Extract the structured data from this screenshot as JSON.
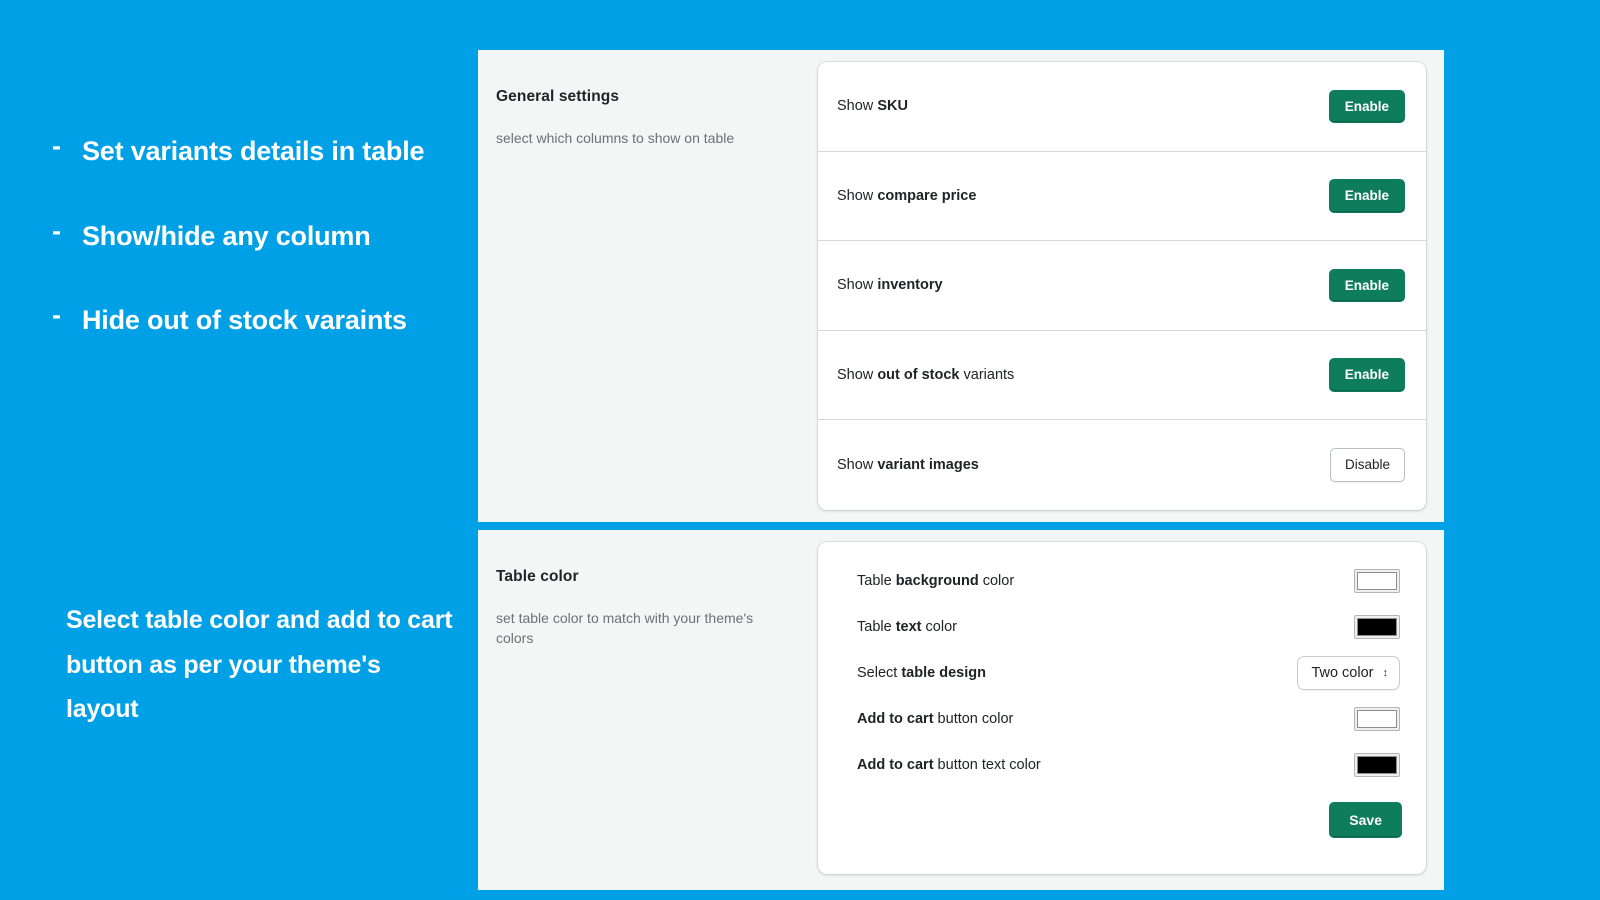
{
  "promo": {
    "bullets": [
      {
        "dash": "-",
        "text": "Set variants details in table"
      },
      {
        "dash": "-",
        "text": "Show/hide any column"
      },
      {
        "dash": "-",
        "text": "Hide out of stock varaints"
      }
    ],
    "paragraph": "Select table color and add to cart button as per your theme's layout"
  },
  "colors": {
    "background_blue": "#00a0e6",
    "panel_grey": "#f4f5f5",
    "primary_green": "#0e7d5b",
    "text_dark": "#212326",
    "text_muted": "#6d7175"
  },
  "general_settings": {
    "title": "General settings",
    "subtitle": "select which columns to show on table",
    "rows": [
      {
        "label_prefix": "Show ",
        "label_strong": "SKU",
        "label_suffix": "",
        "button": "Enable",
        "button_style": "primary"
      },
      {
        "label_prefix": "Show ",
        "label_strong": "compare price",
        "label_suffix": "",
        "button": "Enable",
        "button_style": "primary"
      },
      {
        "label_prefix": "Show ",
        "label_strong": "inventory",
        "label_suffix": "",
        "button": "Enable",
        "button_style": "primary"
      },
      {
        "label_prefix": "Show ",
        "label_strong": "out of stock",
        "label_suffix": " variants",
        "button": "Enable",
        "button_style": "primary"
      },
      {
        "label_prefix": "Show ",
        "label_strong": "variant images",
        "label_suffix": "",
        "button": "Disable",
        "button_style": "secondary"
      }
    ]
  },
  "table_color": {
    "title": "Table color",
    "subtitle": "set table color to match with your theme's colors",
    "rows": [
      {
        "type": "color",
        "label_prefix": "Table ",
        "label_strong": "background",
        "label_suffix": " color",
        "value": "#ffffff"
      },
      {
        "type": "color",
        "label_prefix": "Table ",
        "label_strong": "text",
        "label_suffix": " color",
        "value": "#000000"
      },
      {
        "type": "select",
        "label_prefix": "Select ",
        "label_strong": "table design",
        "label_suffix": "",
        "value": "Two color",
        "arrows": "↕"
      },
      {
        "type": "color",
        "label_prefix": "",
        "label_strong": "Add to cart",
        "label_suffix": " button color",
        "value": "#ffffff"
      },
      {
        "type": "color",
        "label_prefix": "",
        "label_strong": "Add to cart",
        "label_suffix": " button text color",
        "value": "#000000"
      }
    ],
    "save_label": "Save"
  }
}
